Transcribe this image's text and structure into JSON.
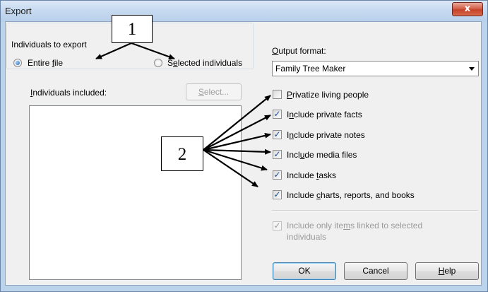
{
  "window": {
    "title": "Export",
    "close_glyph": "x"
  },
  "individuals": {
    "group_label": "Individuals to export",
    "entire_file": {
      "pre": "Entire ",
      "ul": "f",
      "post": "ile",
      "selected": true
    },
    "selected_individuals": {
      "pre": "S",
      "ul": "e",
      "post": "lected individuals",
      "selected": false
    },
    "included_label": {
      "pre": "",
      "ul": "I",
      "post": "ndividuals included:"
    },
    "select_button": {
      "pre": "",
      "ul": "S",
      "post": "elect...",
      "enabled": false
    }
  },
  "output": {
    "label": {
      "pre": "",
      "ul": "O",
      "post": "utput format:"
    },
    "format_value": "Family Tree Maker"
  },
  "options": [
    {
      "pre": "",
      "ul": "P",
      "post": "rivatize living people",
      "checked": false
    },
    {
      "pre": "I",
      "ul": "n",
      "post": "clude private facts",
      "checked": true
    },
    {
      "pre": "I",
      "ul": "n",
      "post": "clude private notes",
      "checked": true
    },
    {
      "pre": "Incl",
      "ul": "u",
      "post": "de media files",
      "checked": true
    },
    {
      "pre": "Include ",
      "ul": "t",
      "post": "asks",
      "checked": true
    },
    {
      "pre": "Include ",
      "ul": "c",
      "post": "harts, reports, and books",
      "checked": true
    }
  ],
  "linked_only": {
    "pre": "Include only ite",
    "ul": "m",
    "post": "s linked  to selected",
    "line2": "individuals",
    "checked": true,
    "enabled": false
  },
  "buttons": {
    "ok": "OK",
    "cancel": "Cancel",
    "help": {
      "pre": "",
      "ul": "H",
      "post": "elp"
    }
  },
  "annotations": {
    "callout_1": "1",
    "callout_2": "2"
  },
  "colors": {
    "accent": "#1f62b3",
    "close": "#c44328",
    "titlebar": "#c7daf0"
  }
}
